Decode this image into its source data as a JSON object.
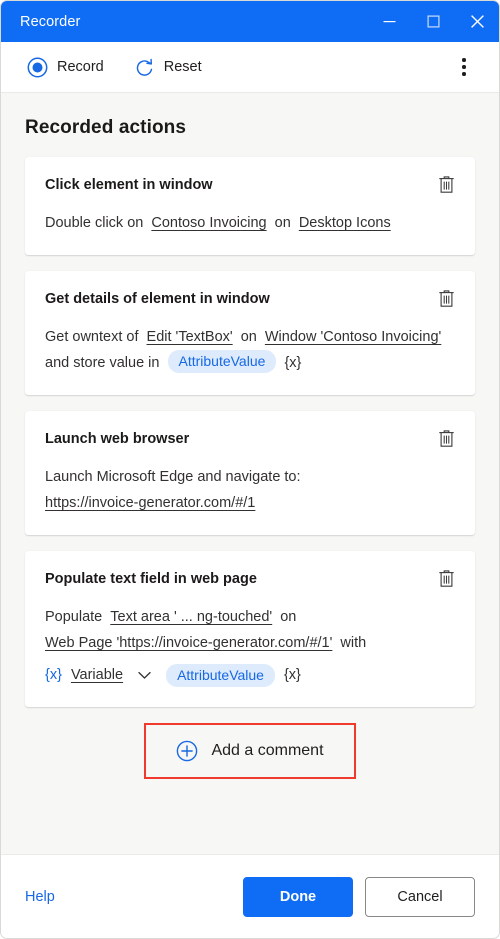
{
  "window": {
    "title": "Recorder",
    "accent": "#0f6cf5",
    "controls": {
      "minimize": "minimize-icon",
      "maximize": "maximize-icon",
      "close": "close-icon"
    }
  },
  "toolbar": {
    "record_label": "Record",
    "reset_label": "Reset",
    "overflow_label": "More options"
  },
  "main": {
    "heading": "Recorded actions",
    "actions": [
      {
        "title": "Click element in window",
        "line1_pre": "Double click on",
        "target": "Contoso Invoicing",
        "mid": "on",
        "scope": "Desktop Icons",
        "delete_label": "Delete action"
      },
      {
        "title": "Get details of element in window",
        "line1_pre": "Get owntext of",
        "target": "Edit 'TextBox'",
        "mid": "on",
        "scope": "Window 'Contoso Invoicing'",
        "line2_pre": "and store value in",
        "chip": "AttributeValue",
        "chip_suffix": "{x}",
        "delete_label": "Delete action"
      },
      {
        "title": "Launch web browser",
        "line1": "Launch Microsoft Edge and navigate to:",
        "url": "https://invoice-generator.com/#/1",
        "delete_label": "Delete action"
      },
      {
        "title": "Populate text field in web page",
        "line1_pre": "Populate",
        "target": "Text area ' ...  ng-touched'",
        "mid": "on",
        "scope": "Web Page 'https://invoice-generator.com/#/1'",
        "with_label": "with",
        "var_prefix": "{x}",
        "var_name": "Variable",
        "chip": "AttributeValue",
        "chip_suffix": "{x}",
        "delete_label": "Delete action"
      }
    ],
    "add_comment": {
      "label": "Add a comment",
      "icon": "plus-circle-icon",
      "highlight_color": "#ef3a2d"
    }
  },
  "footer": {
    "help_label": "Help",
    "done_label": "Done",
    "cancel_label": "Cancel"
  }
}
